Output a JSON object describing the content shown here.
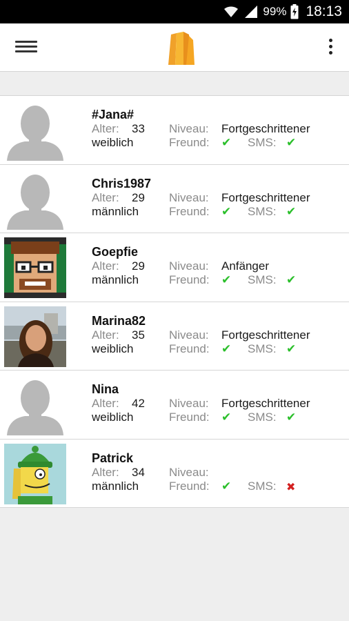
{
  "status_bar": {
    "battery": "99%",
    "time": "18:13"
  },
  "app_bar": {
    "menu_icon": "hamburger-menu-icon",
    "logo_icon": "app-logo-icon",
    "overflow_icon": "more-vert-icon"
  },
  "labels": {
    "age": "Alter:",
    "level": "Niveau:",
    "friend": "Freund:",
    "sms": "SMS:"
  },
  "users": [
    {
      "name": "#Jana#",
      "age": "33",
      "gender": "weiblich",
      "level": "Fortgeschrittener",
      "friend": "yes",
      "sms": "yes",
      "avatar": "default-silhouette"
    },
    {
      "name": "Chris1987",
      "age": "29",
      "gender": "männlich",
      "level": "Fortgeschrittener",
      "friend": "yes",
      "sms": "yes",
      "avatar": "default-silhouette"
    },
    {
      "name": "Goepfie",
      "age": "29",
      "gender": "männlich",
      "level": "Anfänger",
      "friend": "yes",
      "sms": "yes",
      "avatar": "cartoon-glasses"
    },
    {
      "name": "Marina82",
      "age": "35",
      "gender": "weiblich",
      "level": "Fortgeschrittener",
      "friend": "yes",
      "sms": "yes",
      "avatar": "photo-woman"
    },
    {
      "name": "Nina",
      "age": "42",
      "gender": "weiblich",
      "level": "Fortgeschrittener",
      "friend": "yes",
      "sms": "yes",
      "avatar": "default-silhouette"
    },
    {
      "name": "Patrick",
      "age": "34",
      "gender": "männlich",
      "level": "",
      "friend": "yes",
      "sms": "no",
      "avatar": "cartoon-green-hat"
    }
  ],
  "colors": {
    "check": "#2bbf2b",
    "cross": "#d32020",
    "logo": "#f5a623",
    "background": "#eeeeee"
  }
}
